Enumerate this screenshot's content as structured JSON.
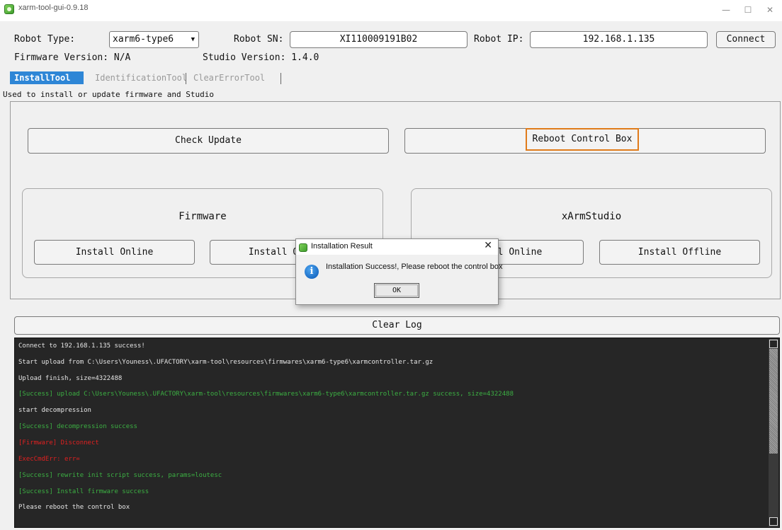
{
  "window": {
    "title": "xarm-tool-gui-0.9.18",
    "minimize": "—",
    "maximize": "☐",
    "close": "✕"
  },
  "top": {
    "robot_type_label": "Robot Type:",
    "robot_type_value": "xarm6-type6",
    "robot_sn_label": "Robot SN:",
    "robot_sn_value": "XI110009191B02",
    "robot_ip_label": "Robot IP:",
    "robot_ip_value": "192.168.1.135",
    "connect_label": "Connect",
    "firmware_version": "Firmware Version: N/A",
    "studio_version": "Studio Version: 1.4.0"
  },
  "tabs": [
    {
      "label": "InstallTool",
      "active": true
    },
    {
      "label": "IdentificationTool",
      "active": false
    },
    {
      "label": "ClearErrorTool",
      "active": false
    }
  ],
  "tab_description": "Used to install or update firmware and Studio",
  "actions": {
    "check_update": "Check Update",
    "reboot_control_box": "Reboot Control Box"
  },
  "groups": {
    "firmware": {
      "title": "Firmware",
      "install_online": "Install Online",
      "install_offline": "Install Offline"
    },
    "studio": {
      "title": "xArmStudio",
      "install_online": "Install Online",
      "install_offline": "Install Offline"
    }
  },
  "log": {
    "clear_label": "Clear Log",
    "lines": [
      {
        "text": "Connect to 192.168.1.135 success!",
        "color": "white"
      },
      {
        "text": "Start upload from C:\\Users\\Youness\\.UFACTORY\\xarm-tool\\resources\\firmwares\\xarm6-type6\\xarmcontroller.tar.gz",
        "color": "white"
      },
      {
        "text": "Upload finish, size=4322488",
        "color": "white"
      },
      {
        "text": "[Success] upload C:\\Users\\Youness\\.UFACTORY\\xarm-tool\\resources\\firmwares\\xarm6-type6\\xarmcontroller.tar.gz success, size=4322488",
        "color": "green"
      },
      {
        "text": "start decompression",
        "color": "white"
      },
      {
        "text": "[Success] decompression success",
        "color": "green"
      },
      {
        "text": "[Firmware] Disconnect",
        "color": "red"
      },
      {
        "text": "ExecCmdErr: err=",
        "color": "red"
      },
      {
        "text": "[Success] rewrite init script success, params=loutesc",
        "color": "green"
      },
      {
        "text": "[Success] Install firmware success",
        "color": "green"
      },
      {
        "text": "Please reboot the control box",
        "color": "white"
      }
    ]
  },
  "dialog": {
    "title": "Installation Result",
    "message": "Installation Success!, Please reboot the control box",
    "ok_label": "OK",
    "close": "✕",
    "info_glyph": "i"
  },
  "colors": {
    "active_tab": "#2e86d6",
    "highlight_border": "#e07b1a",
    "log_bg": "#262626",
    "log_white": "#e6e6e6",
    "log_green": "#3cb043",
    "log_red": "#e02020"
  }
}
